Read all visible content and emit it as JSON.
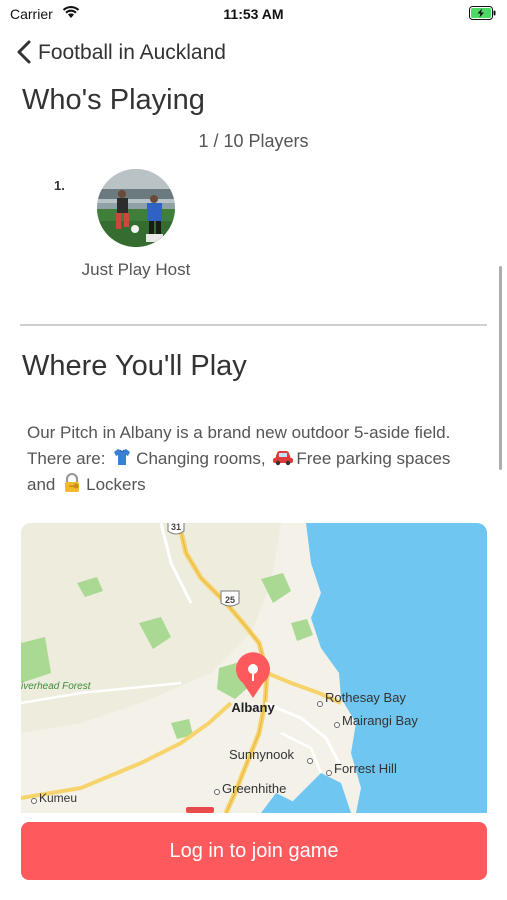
{
  "status_bar": {
    "carrier": "Carrier",
    "time": "11:53 AM"
  },
  "nav": {
    "title": "Football in Auckland"
  },
  "whos_playing": {
    "heading": "Who's Playing",
    "count": "1 / 10 Players",
    "players": [
      {
        "rank": "1.",
        "name": "Just Play Host"
      }
    ]
  },
  "where": {
    "heading": "Where You'll Play",
    "desc_part1": "Our Pitch in Albany is a brand new outdoor 5-aside field. There are:",
    "desc_part2": "Changing rooms,",
    "desc_part3": "Free parking spaces and",
    "desc_part4": "Lockers"
  },
  "map": {
    "road_31": "31",
    "road_25": "25",
    "places": {
      "albany": "Albany",
      "rothesay_bay": "Rothesay Bay",
      "mairangi_bay": "Mairangi Bay",
      "sunnynook": "Sunnynook",
      "forrest_hill": "Forrest Hill",
      "greenhithe": "Greenhithe",
      "kumeu": "Kumeu",
      "riverhead_forest": "iverhead Forest"
    }
  },
  "cta": {
    "label": "Log in to join game"
  },
  "colors": {
    "accent": "#fe5a5e",
    "water": "#6fc6f0",
    "park": "#a9d992"
  }
}
